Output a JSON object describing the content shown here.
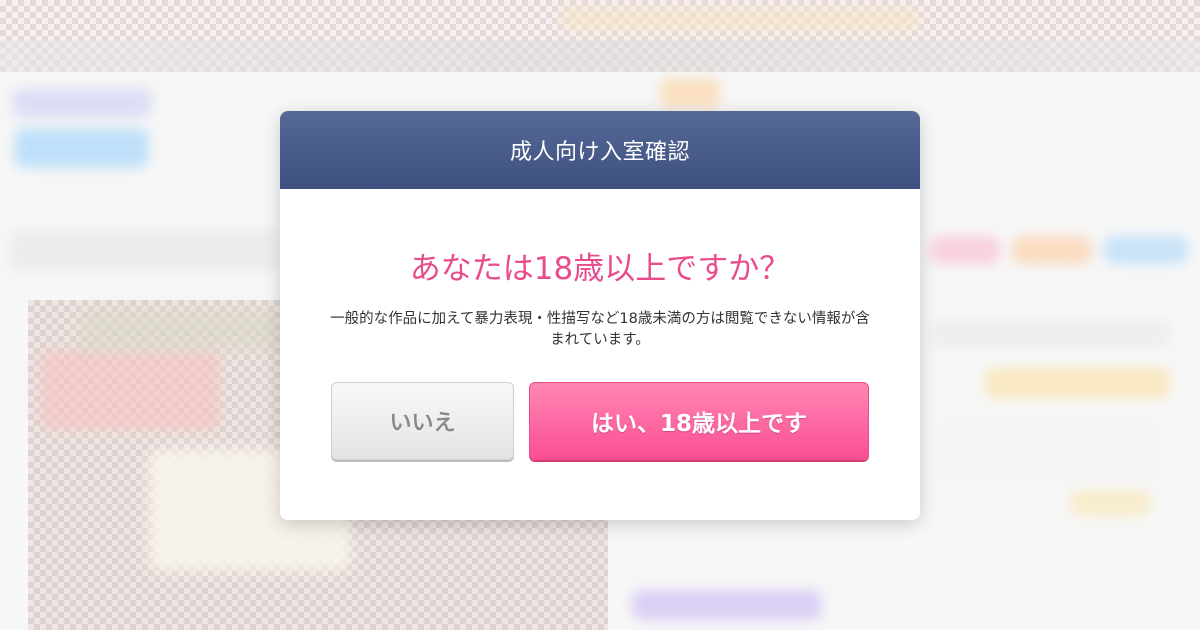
{
  "modal": {
    "title": "成人向け入室確認",
    "question": "あなたは18歳以上ですか？",
    "description": "一般的な作品に加えて暴力表現・性描写など18歳未満の方は閲覧できない情報が含まれています。",
    "no_label": "いいえ",
    "yes_label": "はい、18歳以上です"
  },
  "colors": {
    "header_bg": "#44578a",
    "question_text": "#e94c8c",
    "yes_button": "#fb5d99",
    "no_button": "#e8e8e8"
  }
}
